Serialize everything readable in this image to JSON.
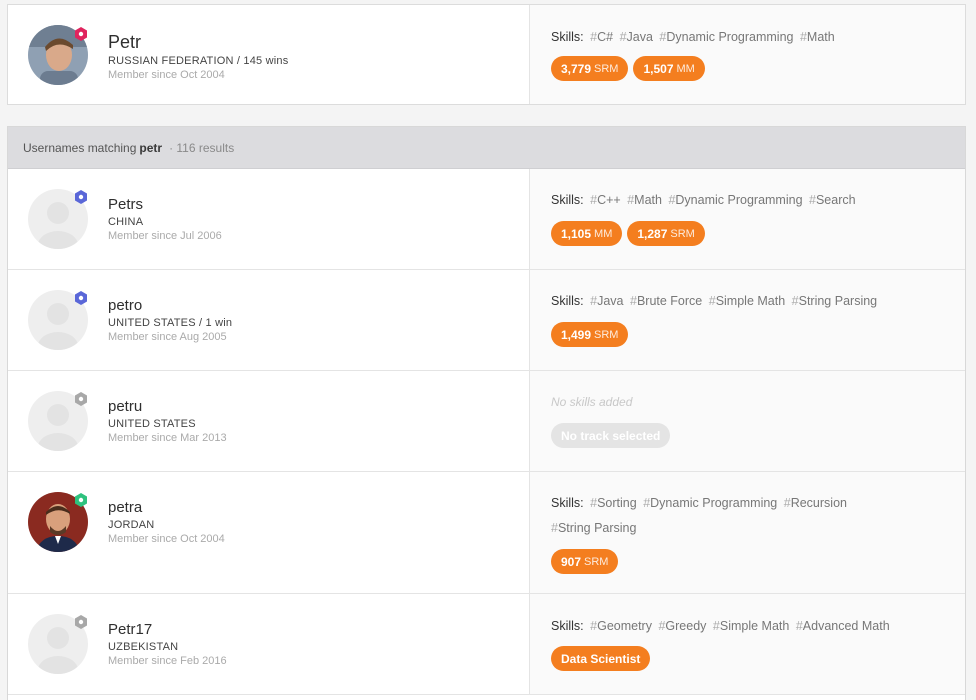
{
  "featured": {
    "handle": "Petr",
    "country": "RUSSIAN FEDERATION / 145 wins",
    "since": "Member since Oct 2004",
    "skills_label": "Skills:",
    "skills": [
      "C#",
      "Java",
      "Dynamic Programming",
      "Math"
    ],
    "ratings": [
      {
        "value": "3,779",
        "unit": "SRM"
      },
      {
        "value": "1,507",
        "unit": "MM"
      }
    ],
    "badge_color": "#e0245e"
  },
  "results_header": {
    "prefix": "Usernames matching",
    "query": "petr",
    "count": "· 116 results"
  },
  "users": [
    {
      "handle": "Petrs",
      "country": "CHINA",
      "since": "Member since Jul 2006",
      "skills_label": "Skills:",
      "skills": [
        "C++",
        "Math",
        "Dynamic Programming",
        "Search"
      ],
      "ratings": [
        {
          "value": "1,105",
          "unit": "MM"
        },
        {
          "value": "1,287",
          "unit": "SRM"
        }
      ],
      "badge_color": "#5a67d8"
    },
    {
      "handle": "petro",
      "country": "UNITED STATES / 1 win",
      "since": "Member since Aug 2005",
      "skills_label": "Skills:",
      "skills": [
        "Java",
        "Brute Force",
        "Simple Math",
        "String Parsing"
      ],
      "ratings": [
        {
          "value": "1,499",
          "unit": "SRM"
        }
      ],
      "badge_color": "#5a67d8"
    },
    {
      "handle": "petru",
      "country": "UNITED STATES",
      "since": "Member since Mar 2013",
      "no_skills": "No skills added",
      "no_track": "No track selected",
      "badge_color": "#a8a8a8"
    },
    {
      "handle": "petra",
      "country": "JORDAN",
      "since": "Member since Oct 2004",
      "skills_label": "Skills:",
      "skills": [
        "Sorting",
        "Dynamic Programming",
        "Recursion",
        "String Parsing"
      ],
      "ratings": [
        {
          "value": "907",
          "unit": "SRM"
        }
      ],
      "badge_color": "#2ec27e"
    },
    {
      "handle": "Petr17",
      "country": "UZBEKISTAN",
      "since": "Member since Feb 2016",
      "skills_label": "Skills:",
      "skills": [
        "Geometry",
        "Greedy",
        "Simple Math",
        "Advanced Math"
      ],
      "track": "Data Scientist",
      "badge_color": "#a8a8a8"
    }
  ],
  "colors": {
    "accent": "#f47e1f",
    "header_bg": "#dcdcdf",
    "pill_disabled": "#e4e4e4"
  }
}
